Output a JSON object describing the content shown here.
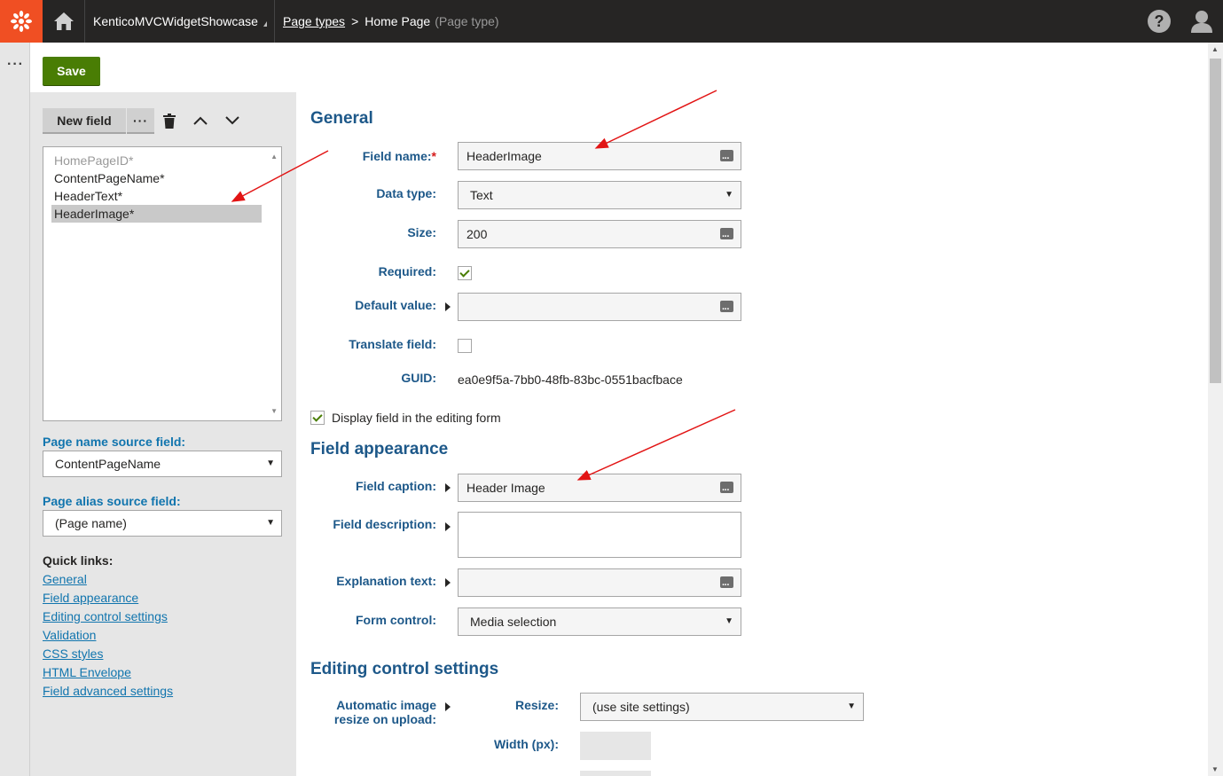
{
  "topbar": {
    "site_name": "KenticoMVCWidgetShowcase",
    "breadcrumb_link": "Page types",
    "breadcrumb_sep": ">",
    "breadcrumb_current": "Home Page",
    "breadcrumb_type": "(Page type)",
    "help_glyph": "?"
  },
  "toolbar": {
    "save_label": "Save"
  },
  "left": {
    "new_field_label": "New field",
    "more_glyph": "···",
    "fields": [
      {
        "label": "HomePageID*",
        "state": "disabled"
      },
      {
        "label": "ContentPageName*",
        "state": "normal"
      },
      {
        "label": "HeaderText*",
        "state": "normal"
      },
      {
        "label": "HeaderImage*",
        "state": "selected"
      }
    ],
    "page_name_source_label": "Page name source field:",
    "page_name_source_value": "ContentPageName",
    "page_alias_source_label": "Page alias source field:",
    "page_alias_source_value": "(Page name)",
    "quick_links_label": "Quick links:",
    "quick_links": [
      "General",
      "Field appearance",
      "Editing control settings",
      "Validation",
      "CSS styles",
      "HTML Envelope",
      "Field advanced settings"
    ]
  },
  "general": {
    "heading": "General",
    "field_name_label": "Field name:",
    "field_name_required": "*",
    "field_name_value": "HeaderImage",
    "data_type_label": "Data type:",
    "data_type_value": "Text",
    "size_label": "Size:",
    "size_value": "200",
    "required_label": "Required:",
    "required_checked": true,
    "default_value_label": "Default value:",
    "default_value": "",
    "translate_label": "Translate field:",
    "translate_checked": false,
    "guid_label": "GUID:",
    "guid_value": "ea0e9f5a-7bb0-48fb-83bc-0551bacfbace",
    "display_field_label": "Display field in the editing form",
    "display_field_checked": true
  },
  "appearance": {
    "heading": "Field appearance",
    "caption_label": "Field caption:",
    "caption_value": "Header Image",
    "description_label": "Field description:",
    "description_value": "",
    "explanation_label": "Explanation text:",
    "explanation_value": "",
    "form_control_label": "Form control:",
    "form_control_value": "Media selection"
  },
  "editing": {
    "heading": "Editing control settings",
    "auto_resize_label_line1": "Automatic image",
    "auto_resize_label_line2": "resize on upload:",
    "resize_label": "Resize:",
    "resize_value": "(use site settings)",
    "width_label": "Width (px):"
  },
  "colors": {
    "logo_bg": "#f04f23",
    "topbar_bg": "#262524",
    "save_bg": "#497d04",
    "label_blue": "#1d5889",
    "link_blue": "#1175ae",
    "annotation_red": "#e21414"
  },
  "icons": [
    "kentico-logo-icon",
    "home-icon",
    "help-icon",
    "user-icon",
    "trash-icon",
    "chevron-up-icon",
    "chevron-down-icon",
    "macro-icon",
    "dropdown-arrow-icon",
    "expander-icon"
  ]
}
